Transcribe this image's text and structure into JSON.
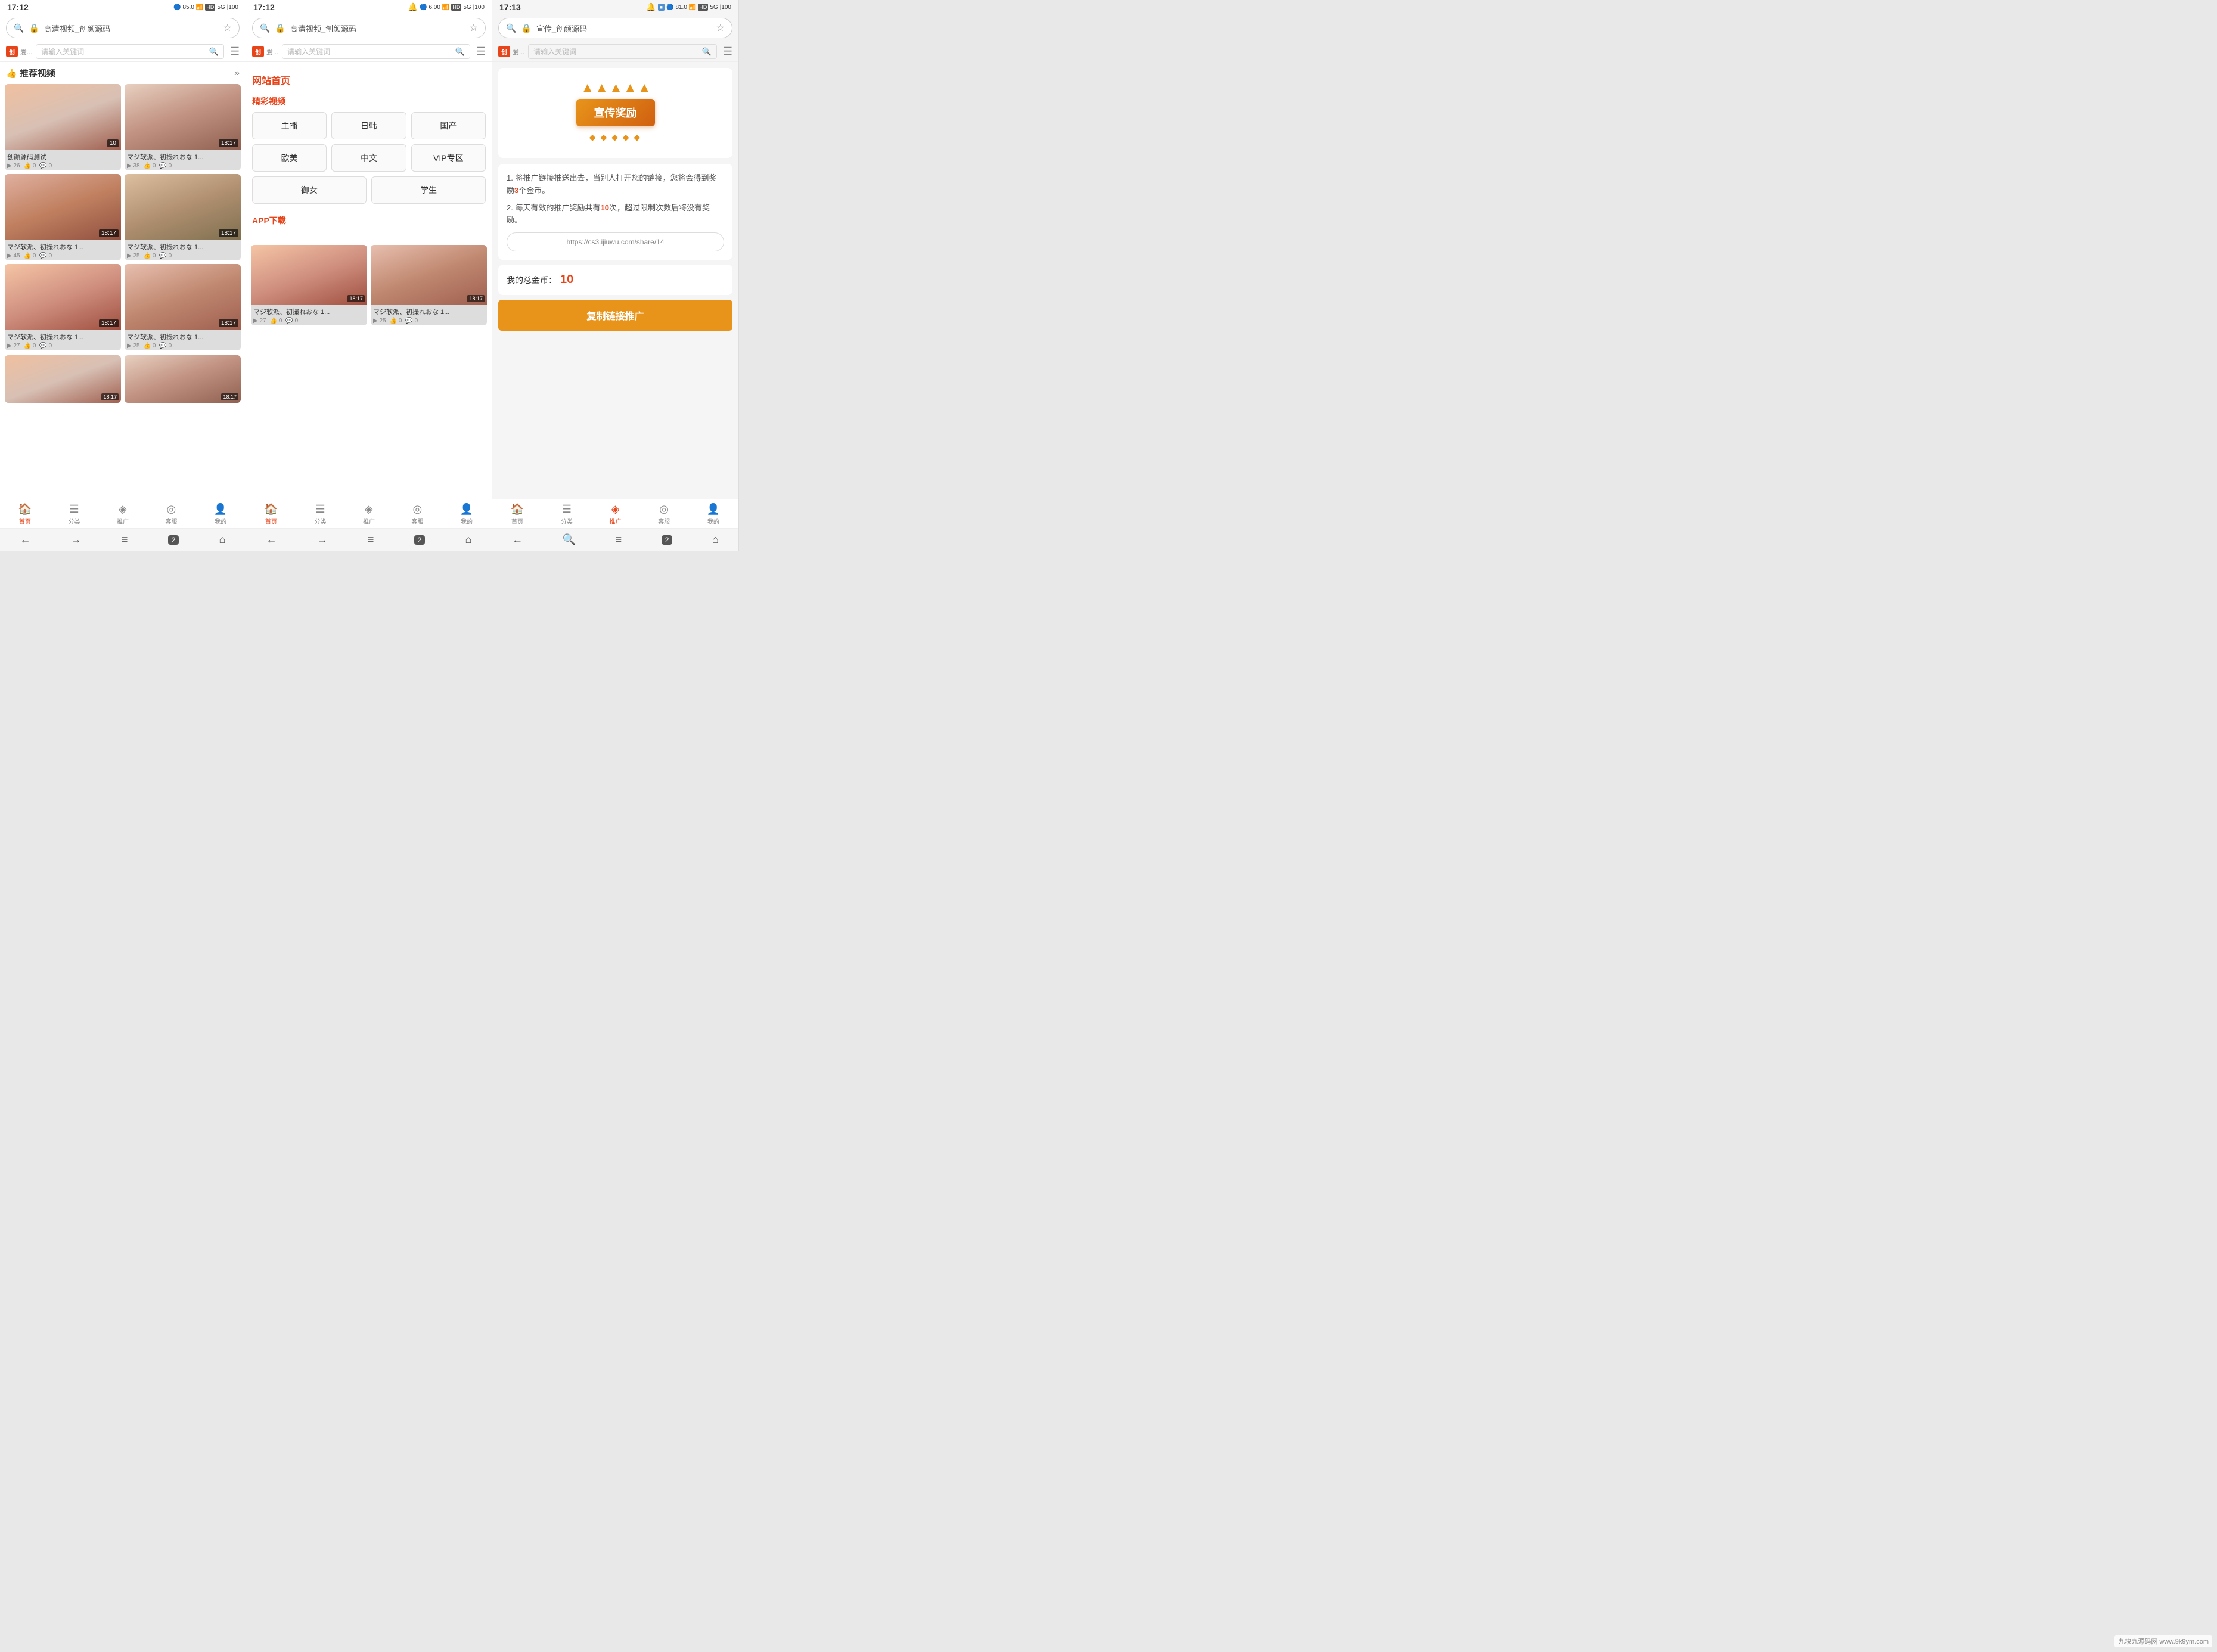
{
  "panel1": {
    "statusTime": "17:12",
    "addressText": "高清视频_创颜源码",
    "searchPlaceholder": "请输入关键词",
    "sectionTitle": "推荐视频",
    "videos": [
      {
        "title": "创颜源码测试",
        "duration": "10",
        "views": "26",
        "likes": "0",
        "thumb": "thumb-1"
      },
      {
        "title": "マジ软派、初撮れおな 1...",
        "duration": "18:17",
        "views": "38",
        "likes": "0",
        "thumb": "thumb-2"
      },
      {
        "title": "マジ软派、初撮れおな 1...",
        "duration": "18:17",
        "views": "45",
        "likes": "0",
        "thumb": "thumb-3"
      },
      {
        "title": "マジ软派、初撮れおな 1...",
        "duration": "18:17",
        "views": "25",
        "likes": "0",
        "thumb": "thumb-4"
      },
      {
        "title": "マジ软派、初撮れおな 1...",
        "duration": "18:17",
        "views": "27",
        "likes": "0",
        "thumb": "thumb-5"
      },
      {
        "title": "マジ软派、初撮れおな 1...",
        "duration": "18:17",
        "views": "25",
        "likes": "0",
        "thumb": "thumb-6"
      }
    ],
    "nav": {
      "items": [
        {
          "label": "首页",
          "icon": "🏠",
          "active": true
        },
        {
          "label": "分类",
          "icon": "☰",
          "active": false
        },
        {
          "label": "推广",
          "icon": "◈",
          "active": false
        },
        {
          "label": "客服",
          "icon": "◎",
          "active": false
        },
        {
          "label": "我的",
          "icon": "👤",
          "active": false
        }
      ]
    }
  },
  "panel2": {
    "statusTime": "17:12",
    "addressText": "高清视频_创颜源码",
    "searchPlaceholder": "请输入关键词",
    "menuSectionTitle": "网站首页",
    "menuSubtitle": "精彩视频",
    "menuItems": [
      {
        "label": "主播"
      },
      {
        "label": "日韩"
      },
      {
        "label": "国产"
      },
      {
        "label": "欧美"
      },
      {
        "label": "中文"
      },
      {
        "label": "VIP专区"
      }
    ],
    "menuItems2": [
      {
        "label": "御女"
      },
      {
        "label": "学生"
      }
    ],
    "appDownloadTitle": "APP下载",
    "videos": [
      {
        "title": "マジ软派、初撮れおな 1...",
        "duration": "18:17",
        "views": "27",
        "likes": "0",
        "thumb": "thumb-5"
      },
      {
        "title": "マジ软派、初撮れおな 1...",
        "duration": "18:17",
        "views": "25",
        "likes": "0",
        "thumb": "thumb-6"
      }
    ],
    "nav": {
      "items": [
        {
          "label": "首页",
          "icon": "🏠",
          "active": true
        },
        {
          "label": "分类",
          "icon": "☰",
          "active": false
        },
        {
          "label": "推广",
          "icon": "◈",
          "active": false
        },
        {
          "label": "客服",
          "icon": "◎",
          "active": false
        },
        {
          "label": "我的",
          "icon": "👤",
          "active": false
        }
      ]
    }
  },
  "panel3": {
    "statusTime": "17:13",
    "addressText": "宣传_创颜源码",
    "searchPlaceholder": "请输入关键词",
    "badgeText": "宣传奖励",
    "desc1": "1. 将推广链接推送出去，当别人打开您的链接，您将会得到奖励",
    "desc1Bold": "3",
    "desc1End": "个金币。",
    "desc2": "2. 每天有效的推广奖励共有",
    "desc2Bold": "10",
    "desc2End": "次，超过限制次数后将没有奖励。",
    "promoLink": "https://cs3.ijiuwu.com/share/14",
    "coinsLabel": "我的总金币：",
    "coinsCount": "10",
    "copyBtnLabel": "复制链接推广",
    "nav": {
      "items": [
        {
          "label": "首页",
          "icon": "🏠",
          "active": false
        },
        {
          "label": "分类",
          "icon": "☰",
          "active": false
        },
        {
          "label": "推广",
          "icon": "◈",
          "active": true
        },
        {
          "label": "客服",
          "icon": "◎",
          "active": false
        },
        {
          "label": "我的",
          "icon": "👤",
          "active": false
        }
      ]
    }
  },
  "watermark": "九块九源码网 www.9k9ym.com"
}
